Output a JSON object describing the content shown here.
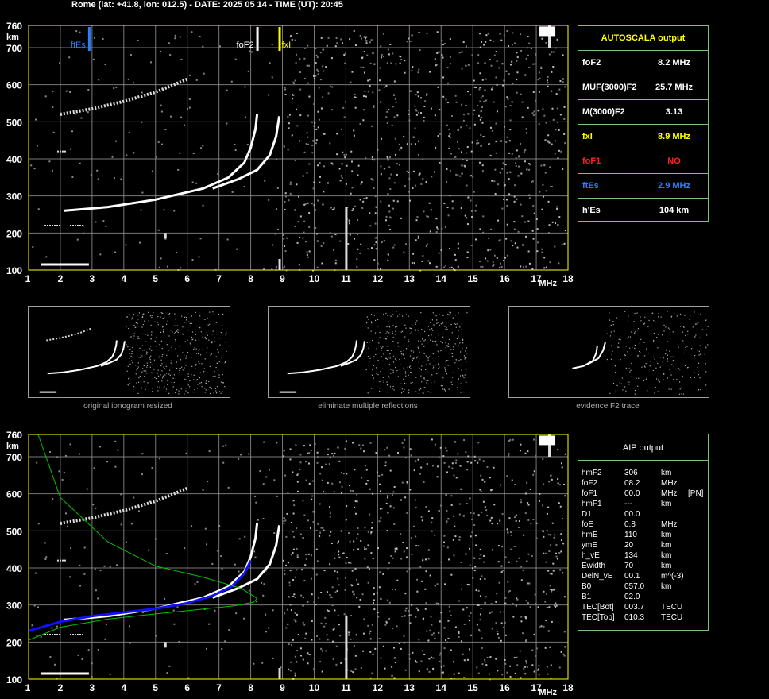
{
  "header": {
    "title": "Rome (lat: +41.8, lon: 012.5) - DATE: 2025 05 14 - TIME (UT): 20:45"
  },
  "colors": {
    "grid": "#a0a0a0",
    "frame": "#ffff00",
    "panel_border": "#7fbf7f",
    "ftEs": "#2a7fff",
    "foF2": "#ffffff",
    "fxI": "#ffff00",
    "foF1": "#ff2020",
    "aip_profile": "#1010ff",
    "aip_model": "#00c000"
  },
  "chart_data": [
    {
      "type": "scatter",
      "title": "",
      "xlabel": "MHz",
      "ylabel": "km",
      "xlim": [
        1,
        18
      ],
      "ylim": [
        100,
        760
      ],
      "x_ticks": [
        "1",
        "2",
        "3",
        "4",
        "5",
        "6",
        "7",
        "8",
        "9",
        "10",
        "11",
        "12",
        "13",
        "14",
        "15",
        "16",
        "17",
        "18"
      ],
      "y_ticks": [
        "100",
        "200",
        "300",
        "400",
        "500",
        "600",
        "700",
        "760"
      ],
      "markers": [
        {
          "label": "ftEs",
          "freq": 2.9,
          "color": "#2a7fff"
        },
        {
          "label": "foF2",
          "freq": 8.2,
          "color": "#ffffff"
        },
        {
          "label": "fxI",
          "freq": 8.9,
          "color": "#ffff00"
        }
      ],
      "traces": {
        "es": {
          "x": [
            1.4,
            2.9
          ],
          "y": 115
        },
        "o_trace": {
          "x": [
            2.1,
            3.5,
            5.0,
            6.5,
            7.3,
            7.8,
            8.0,
            8.15,
            8.2
          ],
          "y": [
            260,
            270,
            290,
            320,
            350,
            390,
            430,
            480,
            520
          ]
        },
        "x_trace": {
          "x": [
            6.8,
            7.6,
            8.2,
            8.6,
            8.8,
            8.9
          ],
          "y": [
            320,
            345,
            370,
            410,
            460,
            515
          ]
        },
        "multiple": {
          "x": [
            2.0,
            3.0,
            4.0,
            5.0,
            6.0
          ],
          "y": [
            520,
            535,
            555,
            580,
            615
          ]
        },
        "es_multiple": [
          {
            "x": [
              1.5,
              2.0
            ],
            "y": 220
          },
          {
            "x": [
              2.3,
              2.7
            ],
            "y": 220
          },
          {
            "x": [
              1.9,
              2.2
            ],
            "y": 420
          }
        ]
      }
    },
    {
      "type": "scatter",
      "title": "",
      "xlabel": "MHz",
      "ylabel": "km",
      "xlim": [
        1,
        18
      ],
      "ylim": [
        100,
        760
      ],
      "x_ticks": [
        "1",
        "2",
        "3",
        "4",
        "5",
        "6",
        "7",
        "8",
        "9",
        "10",
        "11",
        "12",
        "13",
        "14",
        "15",
        "16",
        "17",
        "18"
      ],
      "y_ticks": [
        "100",
        "200",
        "300",
        "400",
        "500",
        "600",
        "700",
        "760"
      ],
      "series": [
        {
          "x": [
            1.0,
            2.0,
            3.0,
            4.0,
            5.0,
            6.0,
            6.8,
            7.4,
            7.8,
            8.0
          ],
          "y": [
            230,
            255,
            270,
            280,
            290,
            305,
            325,
            350,
            385,
            420
          ]
        }
      ],
      "model_profile": {
        "x": [
          1.0,
          2.0,
          3.5,
          5.0,
          6.5,
          7.5,
          8.1,
          8.2,
          7.7,
          6.5,
          5.0,
          3.5,
          2.0,
          1.3
        ],
        "y": [
          205,
          240,
          262,
          276,
          289,
          298,
          308,
          318,
          345,
          375,
          405,
          470,
          590,
          760
        ]
      }
    }
  ],
  "autoscala": {
    "title": "AUTOSCALA output",
    "rows": [
      {
        "label": "foF2",
        "value": "8.2 MHz",
        "color": "#ffffff"
      },
      {
        "label": "MUF(3000)F2",
        "value": "25.7 MHz",
        "color": "#ffffff"
      },
      {
        "label": "M(3000)F2",
        "value": "3.13",
        "color": "#ffffff"
      },
      {
        "label": "fxI",
        "value": "8.9 MHz",
        "color": "#ffff00"
      },
      {
        "label": "foF1",
        "value": "NO",
        "color": "#ff2020"
      },
      {
        "label": "ftEs",
        "value": "2.9 MHz",
        "color": "#2a7fff"
      },
      {
        "label": "h'Es",
        "value": "104    km",
        "color": "#ffffff"
      }
    ]
  },
  "thumbnails": [
    {
      "caption": "original ionogram resized"
    },
    {
      "caption": "eliminate multiple reflections"
    },
    {
      "caption": "evidence F2 trace"
    }
  ],
  "aip": {
    "title": "AIP output",
    "rows": [
      {
        "name": "hmF2",
        "value": "306",
        "unit": "km",
        "extra": ""
      },
      {
        "name": "foF2",
        "value": "08.2",
        "unit": "MHz",
        "extra": ""
      },
      {
        "name": "foF1",
        "value": "00.0",
        "unit": "MHz",
        "extra": "[PN]"
      },
      {
        "name": "hmF1",
        "value": "---",
        "unit": "km",
        "extra": ""
      },
      {
        "name": "D1",
        "value": "00.0",
        "unit": "",
        "extra": ""
      },
      {
        "name": "foE",
        "value": "0.8",
        "unit": "MHz",
        "extra": ""
      },
      {
        "name": "hmE",
        "value": "110",
        "unit": "km",
        "extra": ""
      },
      {
        "name": "ymE",
        "value": "20",
        "unit": "km",
        "extra": ""
      },
      {
        "name": "h_vE",
        "value": "134",
        "unit": "km",
        "extra": ""
      },
      {
        "name": "Ewidth",
        "value": "70",
        "unit": "km",
        "extra": ""
      },
      {
        "name": "DelN_vE",
        "value": "00.1",
        "unit": "m^(-3)",
        "extra": ""
      },
      {
        "name": "B0",
        "value": "057.0",
        "unit": "km",
        "extra": ""
      },
      {
        "name": "B1",
        "value": "02.0",
        "unit": "",
        "extra": ""
      },
      {
        "name": "TEC[Bot]",
        "value": "003.7",
        "unit": "TECU",
        "extra": ""
      },
      {
        "name": "TEC[Top]",
        "value": "010.3",
        "unit": "TECU",
        "extra": ""
      }
    ]
  }
}
